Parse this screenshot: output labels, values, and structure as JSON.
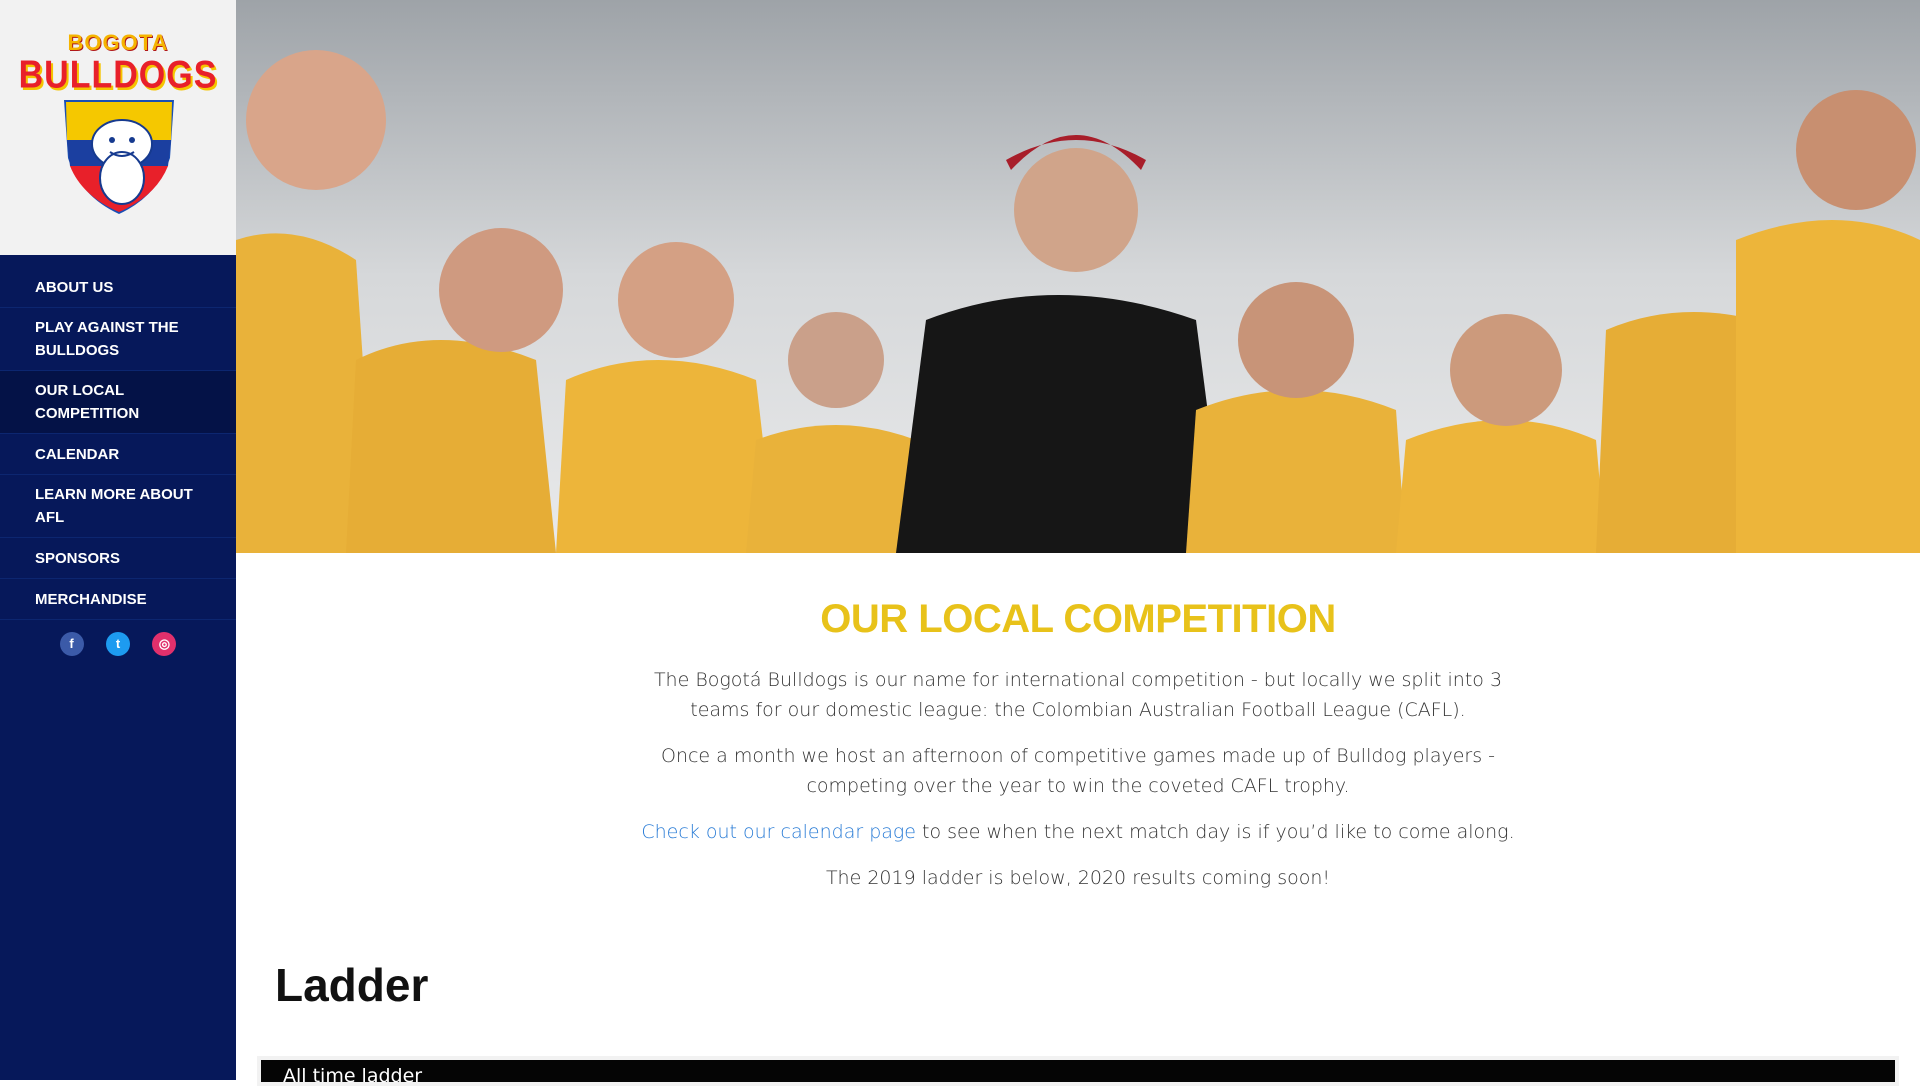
{
  "logo": {
    "top_text": "BOGOTA",
    "main_text": "BULLDOGS"
  },
  "nav": [
    {
      "label": "ABOUT US"
    },
    {
      "label": "PLAY AGAINST THE BULLDOGS"
    },
    {
      "label": "OUR LOCAL COMPETITION",
      "active": true
    },
    {
      "label": "CALENDAR"
    },
    {
      "label": "LEARN MORE ABOUT AFL"
    },
    {
      "label": "SPONSORS"
    },
    {
      "label": "MERCHANDISE"
    }
  ],
  "social": [
    "facebook-icon",
    "twitter-icon",
    "instagram-icon"
  ],
  "colors": {
    "sidebar": "#06185a",
    "title": "#e8c21a",
    "link": "#2a7cd6"
  },
  "main": {
    "title": "OUR LOCAL COMPETITION",
    "para1_line1": "The Bogotá Bulldogs is our name for international competition - but locally we split into 3",
    "para1_line2": "teams for our domestic league: the Colombian Australian Football League (CAFL).",
    "para2_line1": "Once a month we host an afternoon of competitive games made up of Bulldog players -",
    "para2_line2": "competing over the year to win the coveted CAFL trophy.",
    "para3_link": "Check out our calendar page",
    "para3_rest": " to see when the next match day is if you’d like to come along.",
    "para4": "The 2019 ladder is below, 2020 results coming soon!",
    "ladder_heading": "Ladder",
    "ladder_tab": "All time ladder"
  }
}
